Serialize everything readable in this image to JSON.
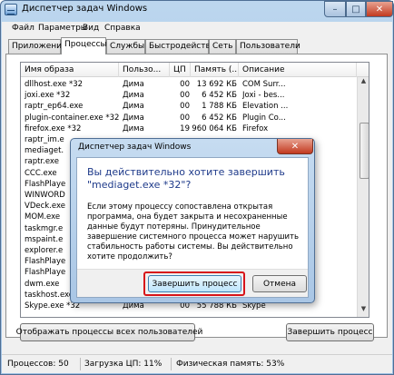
{
  "window": {
    "title": "Диспетчер задач Windows",
    "min_glyph": "–",
    "max_glyph": "□",
    "close_glyph": "✕"
  },
  "menu": [
    "Файл",
    "Параметры",
    "Вид",
    "Справка"
  ],
  "tabs": [
    "Приложения",
    "Процессы",
    "Службы",
    "Быстродействие",
    "Сеть",
    "Пользователи"
  ],
  "active_tab": "Процессы",
  "columns": [
    "Имя образа",
    "Пользо...",
    "ЦП",
    "Память (...",
    "Описание"
  ],
  "rows": [
    {
      "name": "dllhost.exe *32",
      "user": "Дима",
      "cpu": "00",
      "mem": "13 692 КБ",
      "desc": "COM Surr..."
    },
    {
      "name": "joxi.exe *32",
      "user": "Дима",
      "cpu": "00",
      "mem": "6 452 КБ",
      "desc": "Joxi - bes..."
    },
    {
      "name": "raptr_ep64.exe",
      "user": "Дима",
      "cpu": "00",
      "mem": "1 788 КБ",
      "desc": "Elevation ..."
    },
    {
      "name": "plugin-container.exe *32",
      "user": "Дима",
      "cpu": "00",
      "mem": "6 452 КБ",
      "desc": "Plugin Co..."
    },
    {
      "name": "firefox.exe *32",
      "user": "Дима",
      "cpu": "19",
      "mem": "960 064 КБ",
      "desc": "Firefox"
    },
    {
      "name": "raptr_im.e",
      "user": "",
      "cpu": "",
      "mem": "",
      "desc": ""
    },
    {
      "name": "mediaget.",
      "user": "",
      "cpu": "",
      "mem": "",
      "desc": ""
    },
    {
      "name": "raptr.exe",
      "user": "",
      "cpu": "",
      "mem": "",
      "desc": ""
    },
    {
      "name": "CCC.exe",
      "user": "",
      "cpu": "",
      "mem": "",
      "desc": ""
    },
    {
      "name": "FlashPlaye",
      "user": "",
      "cpu": "",
      "mem": "",
      "desc": ""
    },
    {
      "name": "WINWORD",
      "user": "",
      "cpu": "",
      "mem": "",
      "desc": ""
    },
    {
      "name": "VDeck.exe",
      "user": "",
      "cpu": "",
      "mem": "",
      "desc": ""
    },
    {
      "name": "MOM.exe",
      "user": "",
      "cpu": "",
      "mem": "",
      "desc": ""
    },
    {
      "name": "taskmgr.e",
      "user": "",
      "cpu": "",
      "mem": "",
      "desc": ""
    },
    {
      "name": "mspaint.e",
      "user": "",
      "cpu": "",
      "mem": "",
      "desc": ""
    },
    {
      "name": "explorer.e",
      "user": "",
      "cpu": "",
      "mem": "",
      "desc": ""
    },
    {
      "name": "FlashPlaye",
      "user": "",
      "cpu": "",
      "mem": "",
      "desc": ""
    },
    {
      "name": "FlashPlaye",
      "user": "",
      "cpu": "",
      "mem": "",
      "desc": ""
    },
    {
      "name": "dwm.exe",
      "user": "",
      "cpu": "",
      "mem": "",
      "desc": ""
    },
    {
      "name": "taskhost.exe",
      "user": "Дима",
      "cpu": "00",
      "mem": "4 860 КБ",
      "desc": "Хост-про..."
    },
    {
      "name": "Skype.exe *32",
      "user": "Дима",
      "cpu": "00",
      "mem": "55 788 КБ",
      "desc": "Skype"
    }
  ],
  "buttons": {
    "show_all": "Отображать процессы всех пользователей",
    "end_process": "Завершить процесс"
  },
  "status": {
    "processes": "Процессов: 50",
    "cpu": "Загрузка ЦП: 11%",
    "memory": "Физическая память: 53%"
  },
  "dialog": {
    "title": "Диспетчер задач Windows",
    "heading": "Вы действительно хотите завершить \"mediaget.exe *32\"?",
    "body": "Если этому процессу сопоставлена открытая программа, она будет закрыта и несохраненные данные будут потеряны. Принудительное завершение системного процесса может нарушить стабильность работы системы. Вы действительно хотите продолжить?",
    "confirm": "Завершить процесс",
    "cancel": "Отмена",
    "close_glyph": "✕"
  }
}
